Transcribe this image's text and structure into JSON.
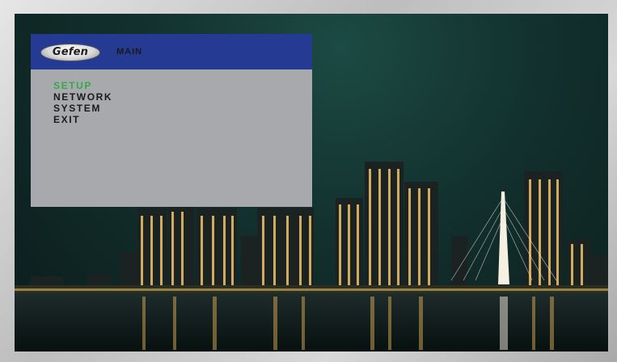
{
  "brand": {
    "logo_text": "Gefen"
  },
  "menu": {
    "title": "MAIN",
    "items": [
      {
        "label": "SETUP",
        "selected": true
      },
      {
        "label": "NETWORK",
        "selected": false
      },
      {
        "label": "SYSTEM",
        "selected": false
      },
      {
        "label": "EXIT",
        "selected": false
      }
    ]
  },
  "colors": {
    "header": "#253a93",
    "menu_bg": "#a8a9ad",
    "selected_item": "#36a84a"
  },
  "background": {
    "description_icon": "city-skyline-night-wallpaper"
  }
}
